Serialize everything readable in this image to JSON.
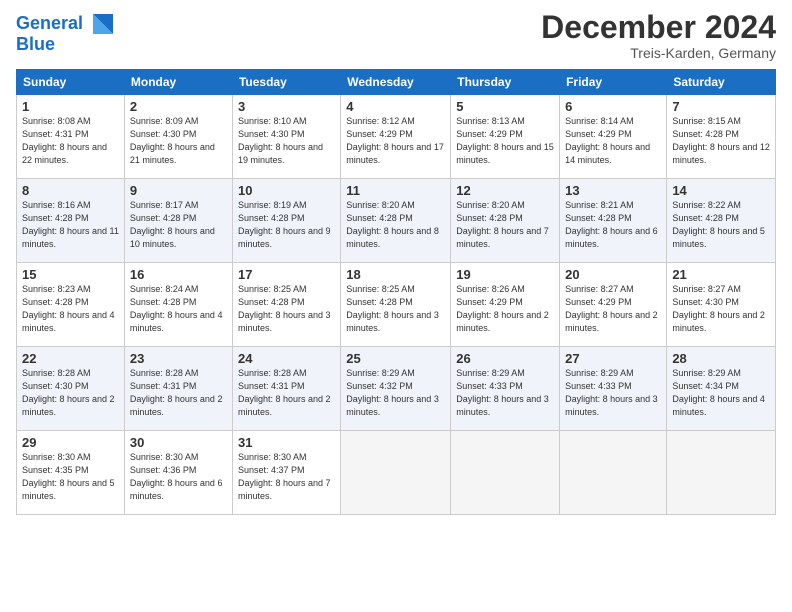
{
  "header": {
    "logo_text1": "General",
    "logo_text2": "Blue",
    "month": "December 2024",
    "location": "Treis-Karden, Germany"
  },
  "weekdays": [
    "Sunday",
    "Monday",
    "Tuesday",
    "Wednesday",
    "Thursday",
    "Friday",
    "Saturday"
  ],
  "weeks": [
    [
      {
        "day": "1",
        "sunrise": "Sunrise: 8:08 AM",
        "sunset": "Sunset: 4:31 PM",
        "daylight": "Daylight: 8 hours and 22 minutes."
      },
      {
        "day": "2",
        "sunrise": "Sunrise: 8:09 AM",
        "sunset": "Sunset: 4:30 PM",
        "daylight": "Daylight: 8 hours and 21 minutes."
      },
      {
        "day": "3",
        "sunrise": "Sunrise: 8:10 AM",
        "sunset": "Sunset: 4:30 PM",
        "daylight": "Daylight: 8 hours and 19 minutes."
      },
      {
        "day": "4",
        "sunrise": "Sunrise: 8:12 AM",
        "sunset": "Sunset: 4:29 PM",
        "daylight": "Daylight: 8 hours and 17 minutes."
      },
      {
        "day": "5",
        "sunrise": "Sunrise: 8:13 AM",
        "sunset": "Sunset: 4:29 PM",
        "daylight": "Daylight: 8 hours and 15 minutes."
      },
      {
        "day": "6",
        "sunrise": "Sunrise: 8:14 AM",
        "sunset": "Sunset: 4:29 PM",
        "daylight": "Daylight: 8 hours and 14 minutes."
      },
      {
        "day": "7",
        "sunrise": "Sunrise: 8:15 AM",
        "sunset": "Sunset: 4:28 PM",
        "daylight": "Daylight: 8 hours and 12 minutes."
      }
    ],
    [
      {
        "day": "8",
        "sunrise": "Sunrise: 8:16 AM",
        "sunset": "Sunset: 4:28 PM",
        "daylight": "Daylight: 8 hours and 11 minutes."
      },
      {
        "day": "9",
        "sunrise": "Sunrise: 8:17 AM",
        "sunset": "Sunset: 4:28 PM",
        "daylight": "Daylight: 8 hours and 10 minutes."
      },
      {
        "day": "10",
        "sunrise": "Sunrise: 8:19 AM",
        "sunset": "Sunset: 4:28 PM",
        "daylight": "Daylight: 8 hours and 9 minutes."
      },
      {
        "day": "11",
        "sunrise": "Sunrise: 8:20 AM",
        "sunset": "Sunset: 4:28 PM",
        "daylight": "Daylight: 8 hours and 8 minutes."
      },
      {
        "day": "12",
        "sunrise": "Sunrise: 8:20 AM",
        "sunset": "Sunset: 4:28 PM",
        "daylight": "Daylight: 8 hours and 7 minutes."
      },
      {
        "day": "13",
        "sunrise": "Sunrise: 8:21 AM",
        "sunset": "Sunset: 4:28 PM",
        "daylight": "Daylight: 8 hours and 6 minutes."
      },
      {
        "day": "14",
        "sunrise": "Sunrise: 8:22 AM",
        "sunset": "Sunset: 4:28 PM",
        "daylight": "Daylight: 8 hours and 5 minutes."
      }
    ],
    [
      {
        "day": "15",
        "sunrise": "Sunrise: 8:23 AM",
        "sunset": "Sunset: 4:28 PM",
        "daylight": "Daylight: 8 hours and 4 minutes."
      },
      {
        "day": "16",
        "sunrise": "Sunrise: 8:24 AM",
        "sunset": "Sunset: 4:28 PM",
        "daylight": "Daylight: 8 hours and 4 minutes."
      },
      {
        "day": "17",
        "sunrise": "Sunrise: 8:25 AM",
        "sunset": "Sunset: 4:28 PM",
        "daylight": "Daylight: 8 hours and 3 minutes."
      },
      {
        "day": "18",
        "sunrise": "Sunrise: 8:25 AM",
        "sunset": "Sunset: 4:28 PM",
        "daylight": "Daylight: 8 hours and 3 minutes."
      },
      {
        "day": "19",
        "sunrise": "Sunrise: 8:26 AM",
        "sunset": "Sunset: 4:29 PM",
        "daylight": "Daylight: 8 hours and 2 minutes."
      },
      {
        "day": "20",
        "sunrise": "Sunrise: 8:27 AM",
        "sunset": "Sunset: 4:29 PM",
        "daylight": "Daylight: 8 hours and 2 minutes."
      },
      {
        "day": "21",
        "sunrise": "Sunrise: 8:27 AM",
        "sunset": "Sunset: 4:30 PM",
        "daylight": "Daylight: 8 hours and 2 minutes."
      }
    ],
    [
      {
        "day": "22",
        "sunrise": "Sunrise: 8:28 AM",
        "sunset": "Sunset: 4:30 PM",
        "daylight": "Daylight: 8 hours and 2 minutes."
      },
      {
        "day": "23",
        "sunrise": "Sunrise: 8:28 AM",
        "sunset": "Sunset: 4:31 PM",
        "daylight": "Daylight: 8 hours and 2 minutes."
      },
      {
        "day": "24",
        "sunrise": "Sunrise: 8:28 AM",
        "sunset": "Sunset: 4:31 PM",
        "daylight": "Daylight: 8 hours and 2 minutes."
      },
      {
        "day": "25",
        "sunrise": "Sunrise: 8:29 AM",
        "sunset": "Sunset: 4:32 PM",
        "daylight": "Daylight: 8 hours and 3 minutes."
      },
      {
        "day": "26",
        "sunrise": "Sunrise: 8:29 AM",
        "sunset": "Sunset: 4:33 PM",
        "daylight": "Daylight: 8 hours and 3 minutes."
      },
      {
        "day": "27",
        "sunrise": "Sunrise: 8:29 AM",
        "sunset": "Sunset: 4:33 PM",
        "daylight": "Daylight: 8 hours and 3 minutes."
      },
      {
        "day": "28",
        "sunrise": "Sunrise: 8:29 AM",
        "sunset": "Sunset: 4:34 PM",
        "daylight": "Daylight: 8 hours and 4 minutes."
      }
    ],
    [
      {
        "day": "29",
        "sunrise": "Sunrise: 8:30 AM",
        "sunset": "Sunset: 4:35 PM",
        "daylight": "Daylight: 8 hours and 5 minutes."
      },
      {
        "day": "30",
        "sunrise": "Sunrise: 8:30 AM",
        "sunset": "Sunset: 4:36 PM",
        "daylight": "Daylight: 8 hours and 6 minutes."
      },
      {
        "day": "31",
        "sunrise": "Sunrise: 8:30 AM",
        "sunset": "Sunset: 4:37 PM",
        "daylight": "Daylight: 8 hours and 7 minutes."
      },
      null,
      null,
      null,
      null
    ]
  ]
}
